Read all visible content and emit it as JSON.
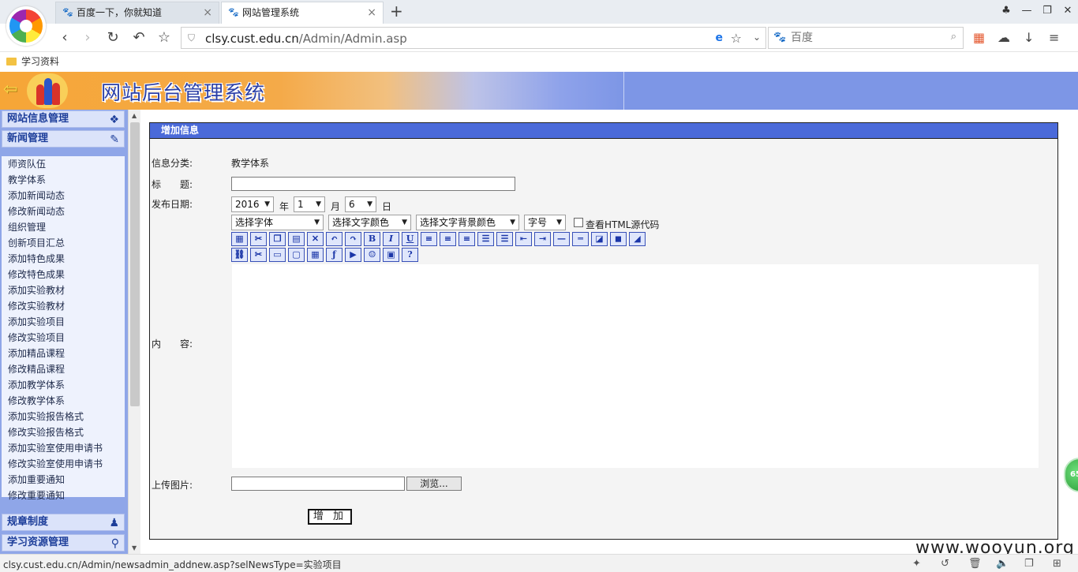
{
  "browser": {
    "tabs": [
      {
        "title": "百度一下，你就知道",
        "active": false
      },
      {
        "title": "网站管理系统",
        "active": true
      }
    ],
    "new_tab": "+",
    "url_host": "clsy.cust.edu.cn",
    "url_path": "/Admin/Admin.asp",
    "search_placeholder": "百度",
    "bookmark": "学习资料",
    "status_url": "clsy.cust.edu.cn/Admin/newsadmin_addnew.asp?selNewsType=实验项目"
  },
  "banner": {
    "title": "网站后台管理系统"
  },
  "sidebar": {
    "section_site": "网站信息管理",
    "section_news": "新闻管理",
    "items": [
      "师资队伍",
      "教学体系",
      "添加新闻动态",
      "修改新闻动态",
      "组织管理",
      "创新项目汇总",
      "添加特色成果",
      "修改特色成果",
      "添加实验教材",
      "修改实验教材",
      "添加实验项目",
      "修改实验项目",
      "添加精品课程",
      "修改精品课程",
      "添加教学体系",
      "修改教学体系",
      "添加实验报告格式",
      "修改实验报告格式",
      "添加实验室使用申请书",
      "修改实验室使用申请书",
      "添加重要通知",
      "修改重要通知"
    ],
    "section_rules": "规章制度",
    "section_learning": "学习资源管理"
  },
  "form": {
    "header": "增加信息",
    "category_label": "信息分类:",
    "category_value": "教学体系",
    "title_label": "标　　题:",
    "date_label": "发布日期:",
    "year": "2016",
    "year_unit": "年",
    "month": "1",
    "month_unit": "月",
    "day": "6",
    "day_unit": "日",
    "font_select": "选择字体",
    "color_select": "选择文字颜色",
    "bgcolor_select": "选择文字背景颜色",
    "size_select": "字号",
    "html_source": "查看HTML源代码",
    "content_label": "内　　容:",
    "upload_label": "上传图片:",
    "browse": "浏览...",
    "submit": "增 加"
  },
  "badge": "65",
  "watermark": "www.wooyun.org"
}
